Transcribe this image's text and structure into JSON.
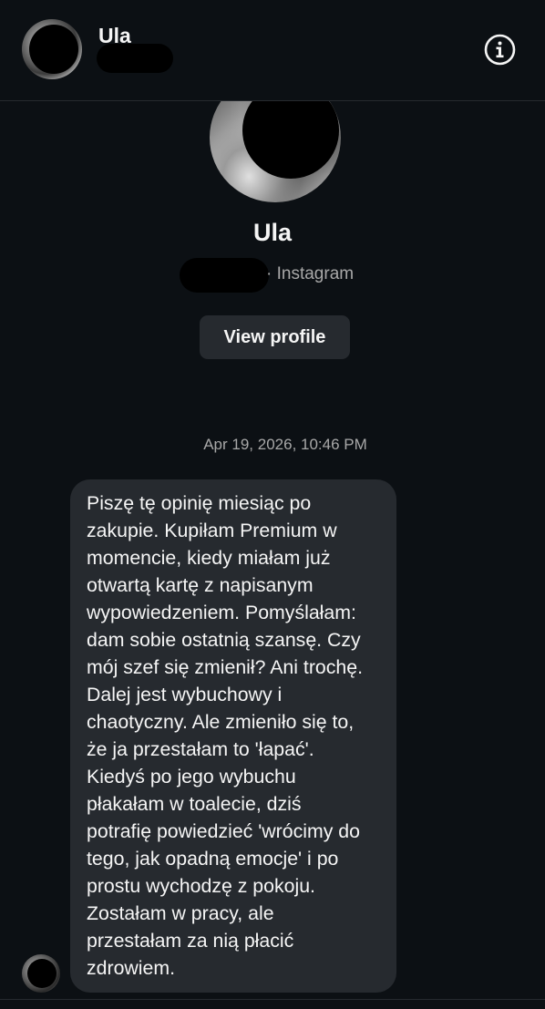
{
  "header": {
    "name": "Ula",
    "info_icon": "info-icon"
  },
  "profile": {
    "name": "Ula",
    "platform": "· Instagram",
    "view_profile_label": "View profile"
  },
  "conversation": {
    "timestamp": "Apr 19, 2026, 10:46 PM",
    "messages": [
      {
        "lines": [
          "Piszę tę opinię miesiąc po",
          "zakupie. Kupiłam Premium w",
          "momencie, kiedy miałam już",
          "otwartą kartę z napisanym",
          "wypowiedzeniem. Pomyślałam:",
          "dam sobie ostatnią szansę. Czy",
          "mój szef się zmienił? Ani trochę.",
          "Dalej jest wybuchowy i",
          "chaotyczny. Ale zmieniło się to,",
          "że ja przestałam to 'łapać'.",
          "Kiedyś po jego wybuchu",
          "płakałam w toalecie, dziś",
          "potrafię powiedzieć 'wrócimy do",
          "tego, jak opadną emocje' i po",
          "prostu wychodzę z pokoju.",
          "Zostałam w pracy, ale",
          "przestałam za nią płacić",
          "zdrowiem."
        ]
      }
    ]
  },
  "colors": {
    "background": "#0c1014",
    "bubble": "#262a2f",
    "muted_text": "#a8a8a8",
    "text": "#f5f5f5"
  }
}
